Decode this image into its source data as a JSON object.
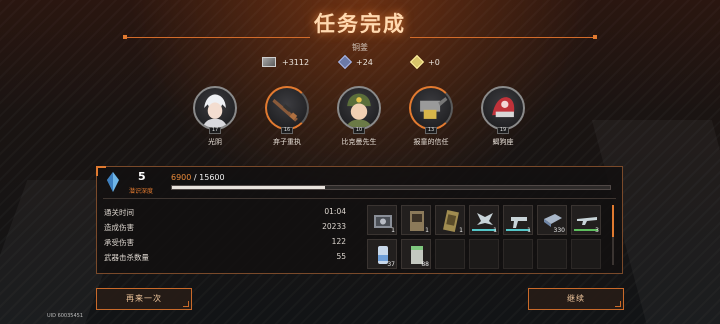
{
  "title": "任务完成",
  "rank": "铜釜",
  "rewards": [
    {
      "icon": "chip-icon",
      "value": "+3112"
    },
    {
      "icon": "cube-icon",
      "value": "+24"
    },
    {
      "icon": "crystal-icon",
      "value": "+0"
    }
  ],
  "characters": [
    {
      "name": "光阴",
      "level": "17",
      "portrait": "white-hair-character"
    },
    {
      "name": "弃子重执",
      "level": "16",
      "portrait": "rifle-weapon"
    },
    {
      "name": "比克曼先生",
      "level": "10",
      "portrait": "green-helmet-character"
    },
    {
      "name": "报童的信任",
      "level": "13",
      "portrait": "mech-weapon"
    },
    {
      "name": "蝎狗座",
      "level": "19",
      "portrait": "red-mech-weapon"
    }
  ],
  "depth": {
    "value": "5",
    "label": "潜识深度"
  },
  "xp": {
    "current": "6900",
    "total": "15600",
    "fraction": 0.35
  },
  "stats": [
    {
      "label": "通关时间",
      "value": "01:04"
    },
    {
      "label": "造成伤害",
      "value": "20233"
    },
    {
      "label": "承受伤害",
      "value": "122"
    },
    {
      "label": "武器击杀数量",
      "value": "55"
    }
  ],
  "items": [
    {
      "icon": "gear-box-icon",
      "qty": "1",
      "color": "#7f8690"
    },
    {
      "icon": "poster-icon",
      "qty": "1",
      "color": "#8c7a5a"
    },
    {
      "icon": "card-icon",
      "qty": "1",
      "color": "#a08c50"
    },
    {
      "icon": "wing-emblem-icon",
      "qty": "1",
      "color": "#55c7c9"
    },
    {
      "icon": "pistol-icon",
      "qty": "1",
      "color": "#55c7c9"
    },
    {
      "icon": "plate-icon",
      "qty": "330",
      "color": "#6f86a8"
    },
    {
      "icon": "rifle-icon",
      "qty": "3",
      "color": "#5fbf5f"
    },
    {
      "icon": "canister-icon",
      "qty": "37",
      "color": "#6f9fd8"
    },
    {
      "icon": "document-icon",
      "qty": "88",
      "color": "#7fc87f"
    }
  ],
  "buttons": {
    "retry": "再来一次",
    "continue": "继续"
  },
  "uid": "UID 60035451"
}
